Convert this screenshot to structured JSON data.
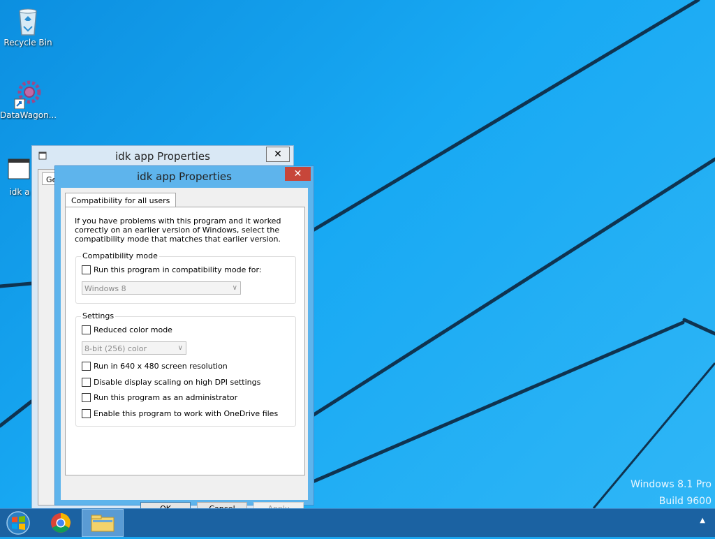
{
  "desktop": {
    "icons": [
      {
        "label": "Recycle Bin",
        "icon": "recycle-bin-icon"
      },
      {
        "label": "DataWagon...",
        "icon": "datawagon-icon"
      },
      {
        "label": "idk a",
        "icon": "app-shortcut-icon"
      }
    ],
    "watermark": {
      "line1": "Windows 8.1 Pro",
      "line2": "Build 9600"
    }
  },
  "back_window": {
    "title": "idk app Properties",
    "close_glyph": "✕",
    "tab_label": "Ge"
  },
  "dialog": {
    "title": "idk app Properties",
    "close_glyph": "✕",
    "tab_label": "Compatibility for all users",
    "intro": "If you have problems with this program and it worked correctly on an earlier version of Windows, select the compatibility mode that matches that earlier version.",
    "compat_group": {
      "title": "Compatibility mode",
      "checkbox_label": "Run this program in compatibility mode for:",
      "checkbox_checked": false,
      "select_value": "Windows 8"
    },
    "settings_group": {
      "title": "Settings",
      "reduced_color_label": "Reduced color mode",
      "reduced_color_checked": false,
      "color_select_value": "8-bit (256) color",
      "options": [
        {
          "label": "Run in 640 x 480 screen resolution",
          "checked": false
        },
        {
          "label": "Disable display scaling on high DPI settings",
          "checked": false
        },
        {
          "label": "Run this program as an administrator",
          "checked": false
        },
        {
          "label": "Enable this program to work with OneDrive files",
          "checked": false
        }
      ]
    },
    "buttons": {
      "ok": "OK",
      "cancel": "Cancel",
      "apply": "Apply"
    }
  },
  "taskbar": {
    "items": [
      {
        "icon": "start-button-icon"
      },
      {
        "icon": "chrome-icon"
      },
      {
        "icon": "file-explorer-icon"
      }
    ],
    "tray_arrow": "▲"
  },
  "colors": {
    "desktop_blue": "#1aa6f0",
    "taskbar": "#1b62a2",
    "close_red": "#c7463a",
    "dialog_frame": "#5eb4ec"
  }
}
